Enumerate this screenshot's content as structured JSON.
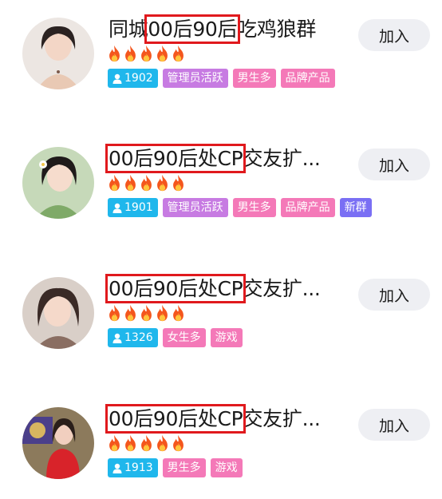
{
  "groups": [
    {
      "title_before": "同城",
      "title_highlight": "00后90后",
      "title_after": "吃鸡狼群",
      "member_count": "1902",
      "tags": [
        {
          "label": "管理员活跃",
          "color": "purple"
        },
        {
          "label": "男生多",
          "color": "pink"
        },
        {
          "label": "品牌产品",
          "color": "pink"
        }
      ],
      "flame_count": 5,
      "join_label": "加入"
    },
    {
      "title_before": "",
      "title_highlight": "00后90后处CP",
      "title_after": "交友扩...",
      "member_count": "1901",
      "tags": [
        {
          "label": "管理员活跃",
          "color": "purple"
        },
        {
          "label": "男生多",
          "color": "pink"
        },
        {
          "label": "品牌产品",
          "color": "pink"
        },
        {
          "label": "新群",
          "color": "blue"
        }
      ],
      "flame_count": 5,
      "join_label": "加入"
    },
    {
      "title_before": "",
      "title_highlight": "00后90后处CP",
      "title_after": "交友扩...",
      "member_count": "1326",
      "tags": [
        {
          "label": "女生多",
          "color": "pink"
        },
        {
          "label": "游戏",
          "color": "pink"
        }
      ],
      "flame_count": 5,
      "join_label": "加入"
    },
    {
      "title_before": "",
      "title_highlight": "00后90后处CP",
      "title_after": "交友扩...",
      "member_count": "1913",
      "tags": [
        {
          "label": "男生多",
          "color": "pink"
        },
        {
          "label": "游戏",
          "color": "pink"
        }
      ],
      "flame_count": 5,
      "join_label": "加入"
    }
  ],
  "icons": {
    "flame": "fire-icon",
    "member": "person-icon"
  },
  "colors": {
    "highlight_box": "#e0191d",
    "count_tag": "#1fb7ec",
    "purple_tag": "#c77be2",
    "pink_tag": "#f479b8",
    "blue_tag": "#7a6ff4",
    "join_button_bg": "#eeeff3"
  }
}
